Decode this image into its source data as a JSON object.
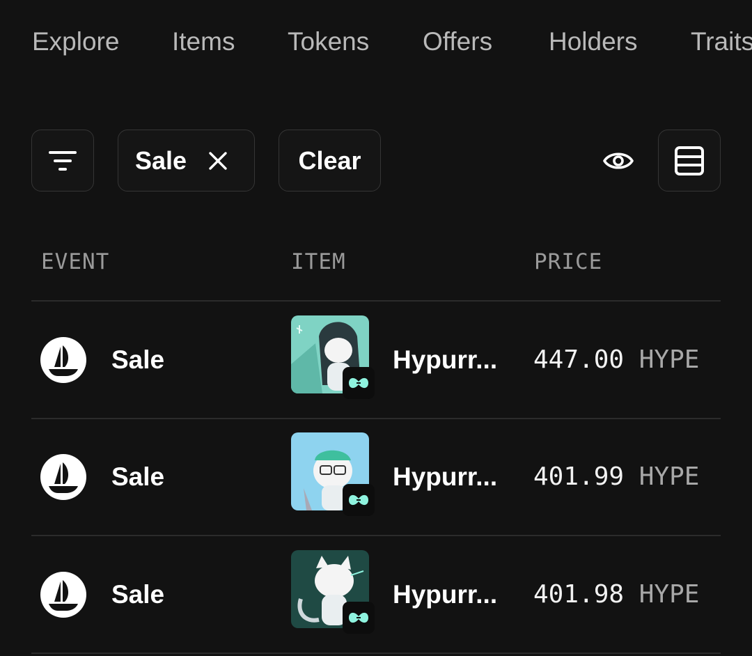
{
  "tabs": [
    "Explore",
    "Items",
    "Tokens",
    "Offers",
    "Holders",
    "Traits"
  ],
  "toolbar": {
    "filter_icon": "filter-lines-icon",
    "active_filter_label": "Sale",
    "clear_label": "Clear",
    "eye_icon": "eye-icon",
    "view_icon": "list-view-icon"
  },
  "table": {
    "headers": {
      "event": "EVENT",
      "item": "ITEM",
      "price": "PRICE"
    },
    "rows": [
      {
        "event": "Sale",
        "item": "Hypurr...",
        "price": "447.00",
        "currency": "HYPE",
        "thumb_bg": "#7fd3c4"
      },
      {
        "event": "Sale",
        "item": "Hypurr...",
        "price": "401.99",
        "currency": "HYPE",
        "thumb_bg": "#8ed3ef"
      },
      {
        "event": "Sale",
        "item": "Hypurr...",
        "price": "401.98",
        "currency": "HYPE",
        "thumb_bg": "#1f4a44"
      }
    ]
  },
  "colors": {
    "background": "#121212",
    "accent_badge": "#8ff3df"
  }
}
